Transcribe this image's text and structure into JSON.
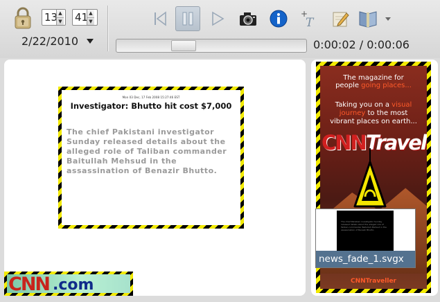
{
  "toolbar": {
    "lock_icon": "lock-icon",
    "spinner_a": "13",
    "spinner_b": "41",
    "date": "2/22/2010",
    "buttons": [
      "skip-to-start-icon",
      "pause-icon",
      "play-icon",
      "camera-icon",
      "info-icon",
      "add-text-icon",
      "edit-icon",
      "book-icon"
    ],
    "progress_fraction": 0.33,
    "time": "0:00:02 / 0:00:06"
  },
  "article": {
    "meta": "Mon 03 Dec, 17 Feb 2008 15:27:46 EST",
    "headline": "Investigator: Bhutto hit cost $7,000",
    "body": "The chief Pakistani investigator Sunday released details about the alleged role of Taliban commander Baitullah Mehsud in the assassination of Benazir Bhutto."
  },
  "cnn_banner": {
    "logo": "CNN",
    "domain": ".com"
  },
  "magazine": {
    "tagline_1": "The magazine for",
    "tagline_2a": "people ",
    "tagline_2b": "going places...",
    "desc_1": "Taking you on a ",
    "desc_1b": "visual",
    "desc_2a": "journey",
    "desc_2b": " to the most",
    "desc_3": "vibrant places on earth...",
    "title_cnn": "CNN",
    "title_word": "Traveller",
    "footer": "CNNTraveller"
  },
  "thumbnail": {
    "filename": "news_fade_1.svgx"
  },
  "colors": {
    "hazard_black": "#000000",
    "hazard_yellow": "#f2ea00",
    "selection_blue": "#54728f"
  }
}
